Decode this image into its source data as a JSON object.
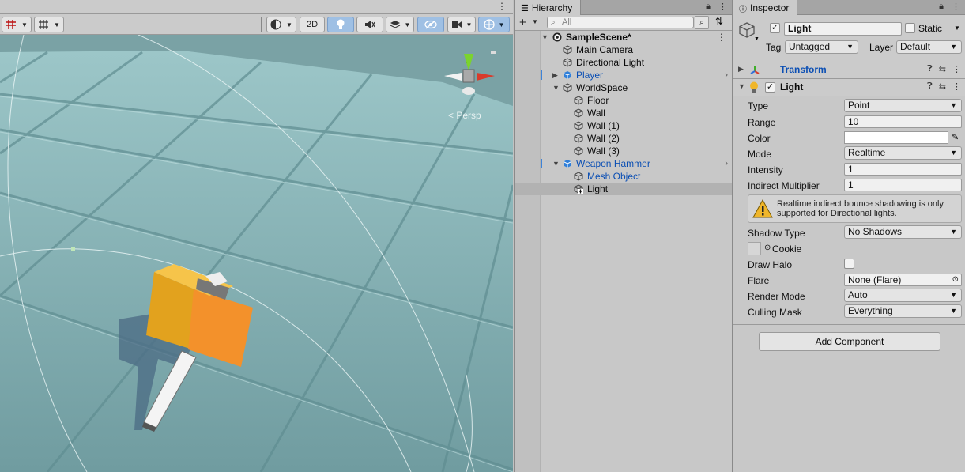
{
  "scene": {
    "toolbar": {
      "mode_2d": "2D",
      "persp_label": "< Persp"
    },
    "gizmo": {
      "y": "y"
    }
  },
  "hierarchy": {
    "tab_label": "Hierarchy",
    "search_placeholder": "All",
    "rows": [
      {
        "label": "SampleScene*",
        "depth": 0
      },
      {
        "label": "Main Camera",
        "depth": 1
      },
      {
        "label": "Directional Light",
        "depth": 1
      },
      {
        "label": "Player",
        "depth": 1
      },
      {
        "label": "WorldSpace",
        "depth": 1
      },
      {
        "label": "Floor",
        "depth": 2
      },
      {
        "label": "Wall",
        "depth": 2
      },
      {
        "label": "Wall (1)",
        "depth": 2
      },
      {
        "label": "Wall (2)",
        "depth": 2
      },
      {
        "label": "Wall (3)",
        "depth": 2
      },
      {
        "label": "Weapon Hammer",
        "depth": 1
      },
      {
        "label": "Mesh Object",
        "depth": 2
      },
      {
        "label": "Light",
        "depth": 2
      }
    ]
  },
  "inspector": {
    "tab_label": "Inspector",
    "object_name": "Light",
    "static_label": "Static",
    "tag_label": "Tag",
    "tag_value": "Untagged",
    "layer_label": "Layer",
    "layer_value": "Default",
    "transform_title": "Transform",
    "light_title": "Light",
    "props": {
      "type_label": "Type",
      "type_value": "Point",
      "range_label": "Range",
      "range_value": "10",
      "color_label": "Color",
      "color_value": "#ffffff",
      "mode_label": "Mode",
      "mode_value": "Realtime",
      "intensity_label": "Intensity",
      "intensity_value": "1",
      "indirect_label": "Indirect Multiplier",
      "indirect_value": "1",
      "warning": "Realtime indirect bounce shadowing is only supported for Directional lights.",
      "shadow_label": "Shadow Type",
      "shadow_value": "No Shadows",
      "cookie_label": "Cookie",
      "halo_label": "Draw Halo",
      "flare_label": "Flare",
      "flare_value": "None (Flare)",
      "render_label": "Render Mode",
      "render_value": "Auto",
      "culling_label": "Culling Mask",
      "culling_value": "Everything"
    },
    "add_component": "Add Component"
  }
}
